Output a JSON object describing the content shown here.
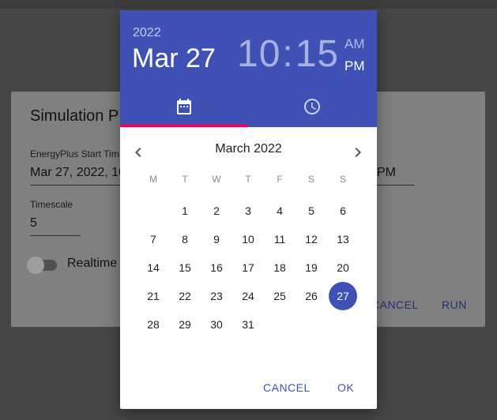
{
  "background_dialog": {
    "title": "Simulation P",
    "start_time_label": "EnergyPlus Start Tim",
    "start_time_value": "Mar 27, 2022, 10",
    "end_value_fragment": "PM",
    "timescale_label": "Timescale",
    "timescale_value": "5",
    "realtime_label": "Realtime",
    "realtime_on": false,
    "cancel_label": "CANCEL",
    "run_label": "RUN"
  },
  "picker": {
    "year": "2022",
    "date": "Mar 27",
    "hour": "10",
    "colon": ":",
    "minute": "15",
    "am": "AM",
    "pm": "PM",
    "tabs": [
      {
        "icon": "calendar-icon",
        "active": true
      },
      {
        "icon": "clock-icon",
        "active": false
      }
    ],
    "month_title": "March 2022",
    "weekdays": [
      "M",
      "T",
      "W",
      "T",
      "F",
      "S",
      "S"
    ],
    "weeks": [
      [
        "",
        "1",
        "2",
        "3",
        "4",
        "5",
        "6"
      ],
      [
        "7",
        "8",
        "9",
        "10",
        "11",
        "12",
        "13"
      ],
      [
        "14",
        "15",
        "16",
        "17",
        "18",
        "19",
        "20"
      ],
      [
        "21",
        "22",
        "23",
        "24",
        "25",
        "26",
        "27"
      ],
      [
        "28",
        "29",
        "30",
        "31",
        "",
        "",
        ""
      ]
    ],
    "selected_day": "27",
    "cancel_label": "CANCEL",
    "ok_label": "OK"
  },
  "colors": {
    "primary": "#3f51b5",
    "tab_indicator": "#f50057",
    "backdrop": "#464646"
  }
}
